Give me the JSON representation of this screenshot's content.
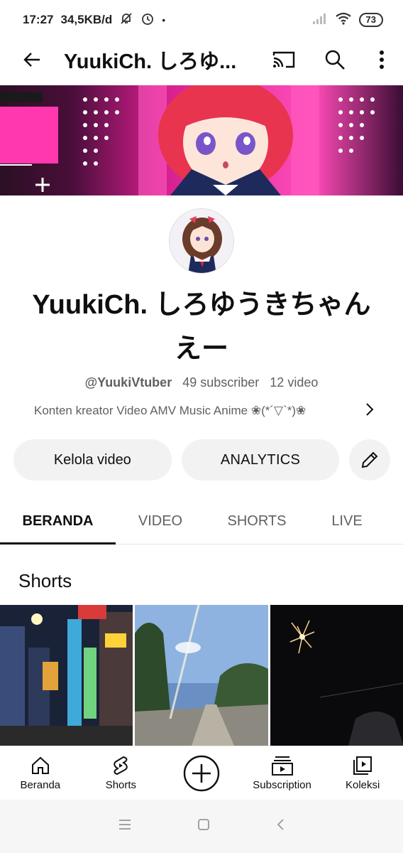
{
  "status_bar": {
    "time": "17:27",
    "speed": "34,5KB/d",
    "battery": "73"
  },
  "app_bar": {
    "title": "YuukiCh. しろゆ..."
  },
  "channel": {
    "name": "YuukiCh. しろゆうきちゃん えー",
    "handle": "@YuukiVtuber",
    "subscribers": "49 subscriber",
    "videos": "12 video",
    "description": "Konten kreator Video AMV Music Anime ❀(*´▽`*)❀"
  },
  "actions": {
    "manage_label": "Kelola video",
    "analytics_label": "ANALYTICS"
  },
  "tabs": [
    {
      "label": "BERANDA",
      "active": true
    },
    {
      "label": "VIDEO",
      "active": false
    },
    {
      "label": "SHORTS",
      "active": false
    },
    {
      "label": "LIVE",
      "active": false
    }
  ],
  "shorts": {
    "title": "Shorts"
  },
  "bottom_nav": [
    {
      "label": "Beranda",
      "icon": "home-icon"
    },
    {
      "label": "Shorts",
      "icon": "shorts-icon"
    },
    {
      "label": "",
      "icon": "add-icon"
    },
    {
      "label": "Subscription",
      "icon": "subscriptions-icon"
    },
    {
      "label": "Koleksi",
      "icon": "library-icon"
    }
  ],
  "colors": {
    "banner_accent": "#e0208f",
    "text_primary": "#0f0f0f",
    "text_secondary": "#606060",
    "pill_bg": "#f2f2f2"
  }
}
